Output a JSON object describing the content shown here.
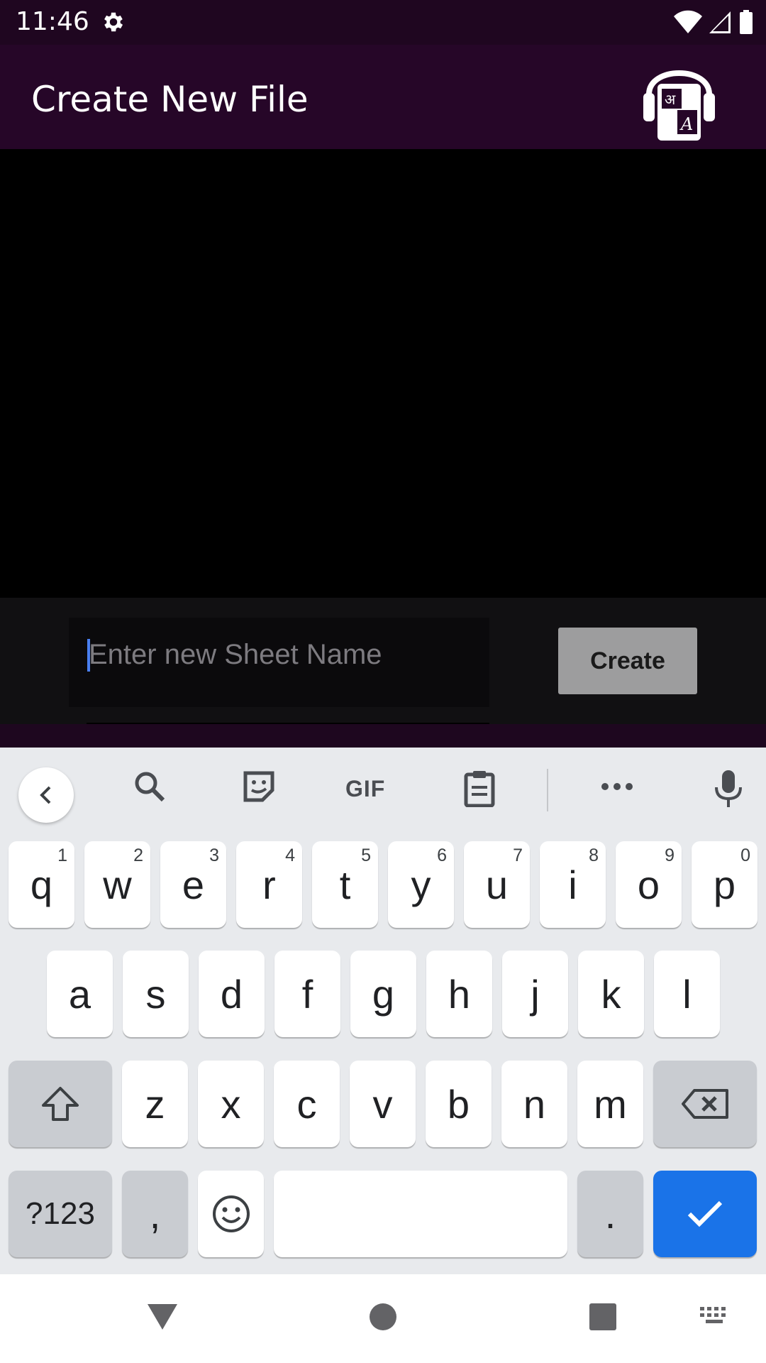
{
  "status_bar": {
    "time": "11:46",
    "icons": [
      "gear-icon",
      "wifi-icon",
      "signal-icon",
      "battery-icon"
    ]
  },
  "app_bar": {
    "title": "Create New File",
    "logo": "headphones-translate-logo"
  },
  "form": {
    "input_placeholder": "Enter new Sheet Name",
    "input_value": "",
    "create_label": "Create"
  },
  "keyboard": {
    "toolbar": [
      "back-icon",
      "search-icon",
      "sticker-icon",
      "GIF",
      "clipboard-icon",
      "more-icon",
      "mic-icon"
    ],
    "gif_label": "GIF",
    "row1": [
      {
        "k": "q",
        "h": "1"
      },
      {
        "k": "w",
        "h": "2"
      },
      {
        "k": "e",
        "h": "3"
      },
      {
        "k": "r",
        "h": "4"
      },
      {
        "k": "t",
        "h": "5"
      },
      {
        "k": "y",
        "h": "6"
      },
      {
        "k": "u",
        "h": "7"
      },
      {
        "k": "i",
        "h": "8"
      },
      {
        "k": "o",
        "h": "9"
      },
      {
        "k": "p",
        "h": "0"
      }
    ],
    "row2": [
      "a",
      "s",
      "d",
      "f",
      "g",
      "h",
      "j",
      "k",
      "l"
    ],
    "row3": [
      "z",
      "x",
      "c",
      "v",
      "b",
      "n",
      "m"
    ],
    "symbols_label": "?123",
    "comma_label": ",",
    "period_label": "."
  },
  "nav_bar": [
    "back-triangle-icon",
    "home-circle-icon",
    "recents-square-icon",
    "keyboard-switch-icon"
  ],
  "colors": {
    "status_bar": "#1f0620",
    "app_bar": "#260628",
    "accent_blue": "#1a73e8",
    "button_gray": "#9d9d9e"
  }
}
